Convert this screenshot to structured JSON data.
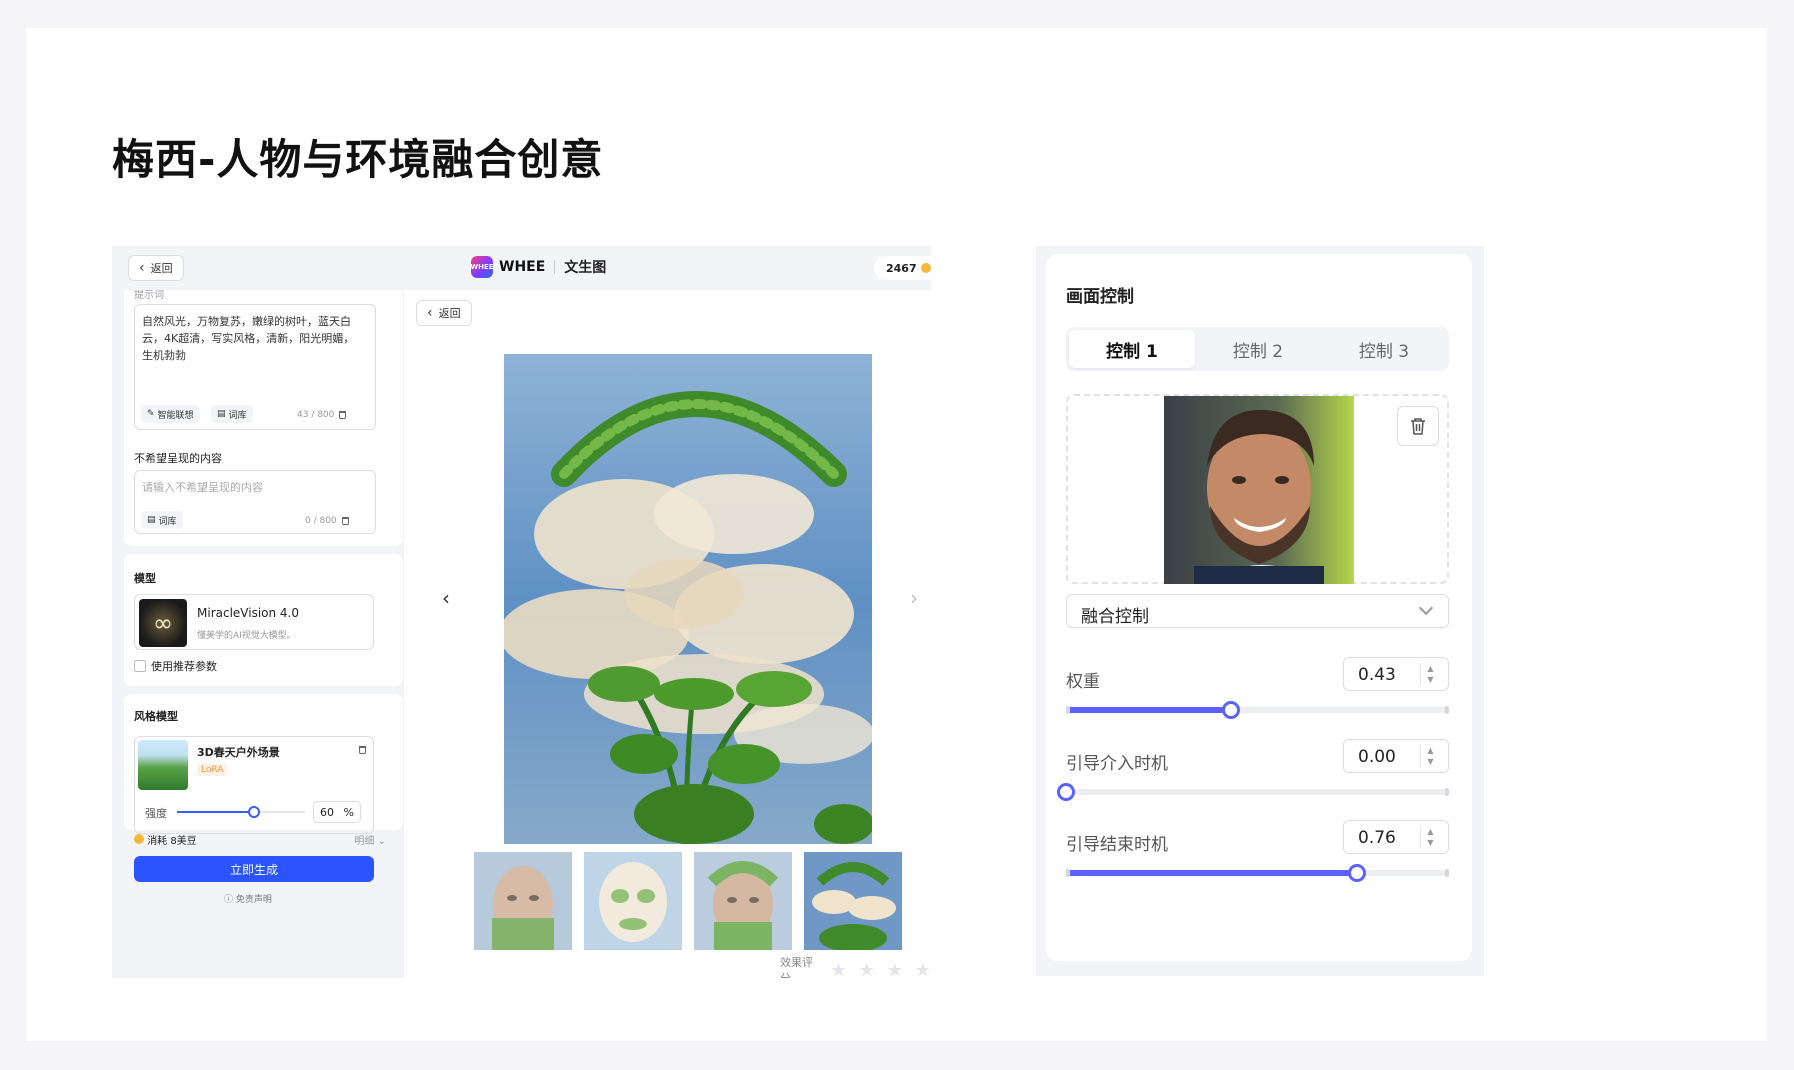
{
  "page": {
    "title": "梅西-人物与环境融合创意"
  },
  "app": {
    "back_label": "返回",
    "brand_logo_text": "WHEE",
    "brand_name": "WHEE",
    "brand_sub": "文生图",
    "coins": "2467",
    "prompt": {
      "label": "提示词",
      "text": "自然风光，万物复苏，嫩绿的树叶，蓝天白云，4K超清，写实风格，清新，阳光明媚，生机勃勃",
      "chip_assoc": "智能联想",
      "chip_lib": "词库",
      "counter": "43 / 800"
    },
    "negative": {
      "label": "不希望呈现的内容",
      "placeholder": "请输入不希望呈现的内容",
      "chip_lib": "词库",
      "counter": "0 / 800"
    },
    "model": {
      "label": "模型",
      "name": "MiracleVision 4.0",
      "desc": "懂美学的AI视觉大模型。",
      "checkbox_label": "使用推荐参数"
    },
    "style_model": {
      "label": "风格模型",
      "name": "3D春天户外场景",
      "tag": "LoRA",
      "strength_label": "强度",
      "strength_value": "60",
      "strength_unit": "%",
      "strength_fraction": 0.6
    },
    "cost_label": "消耗 8美豆",
    "detail_label": "明细",
    "generate_label": "立即生成",
    "disclaimer": "免责声明",
    "main_back_label": "返回",
    "rating_label": "效果评分"
  },
  "control": {
    "title": "画面控制",
    "tabs": [
      {
        "label": "控制 1",
        "active": true
      },
      {
        "label": "控制 2",
        "active": false
      },
      {
        "label": "控制 3",
        "active": false
      }
    ],
    "mode": "融合控制",
    "params": [
      {
        "label": "权重",
        "value": "0.43",
        "fraction": 0.43
      },
      {
        "label": "引导介入时机",
        "value": "0.00",
        "fraction": 0.0
      },
      {
        "label": "引导结束时机",
        "value": "0.76",
        "fraction": 0.76
      }
    ]
  },
  "colors": {
    "accent": "#2b54ff",
    "slider": "#5b62ff",
    "lora": "#f29545"
  }
}
